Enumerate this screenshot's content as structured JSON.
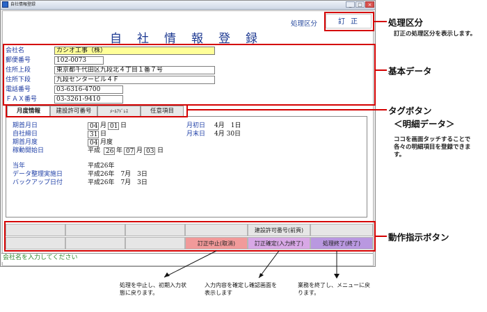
{
  "window": {
    "title": "自社情報登録",
    "controls": [
      "_",
      "□",
      "×"
    ]
  },
  "header": {
    "mode_label": "処理区分",
    "mode_value": "訂正",
    "page_title": "自社情報登録"
  },
  "basic_data": {
    "fields": [
      {
        "label": "会社名",
        "value": "カシオ工事（株）"
      },
      {
        "label": "郵便番号",
        "value": "102-0073"
      },
      {
        "label": "住所上段",
        "value": "東京都千代田区九段北４丁目１番７号"
      },
      {
        "label": "住所下段",
        "value": "九段センタービル４Ｆ"
      },
      {
        "label": "電話番号",
        "value": "03-6316-4700"
      },
      {
        "label": "ＦＡＸ番号",
        "value": "03-3261-9410"
      }
    ]
  },
  "tabs": [
    {
      "label": "月度情報"
    },
    {
      "label": "建設許可番号"
    },
    {
      "label": "ﾒｰﾙｱﾄﾞﾚｽ"
    },
    {
      "label": "任意項目"
    }
  ],
  "detail": {
    "period_start_month": {
      "label": "期首月日",
      "month": "04",
      "month_unit": "月",
      "day": "01",
      "day_unit": "日"
    },
    "closing_day": {
      "label": "自社締日",
      "value": "31",
      "unit": "日"
    },
    "period_start_fy": {
      "label": "期首月度",
      "value": "04",
      "unit": "月度"
    },
    "operation_start": {
      "label": "稼動開始日",
      "era": "平成",
      "year": "26",
      "year_unit": "年",
      "month": "07",
      "month_unit": "月",
      "day": "03",
      "day_unit": "日"
    },
    "month_first": {
      "label": "月初日",
      "value": "4月　1日"
    },
    "month_end": {
      "label": "月末日",
      "value": "4月 30日"
    },
    "current_year": {
      "label": "当年",
      "value": "平成26年"
    },
    "data_cleanup": {
      "label": "データ整理実施日",
      "value": "平成26年　7月　3日"
    },
    "backup_date": {
      "label": "バックアップ日付",
      "value": "平成26年　7月　3日"
    }
  },
  "action_buttons": {
    "top_row": [
      "",
      "",
      "",
      "",
      "",
      "建設許可番号(前頁)",
      ""
    ],
    "bottom_row": [
      "",
      "",
      "",
      "",
      "訂正中止(取消)",
      "訂正確定(入力終了)",
      "処理終了(終了)"
    ]
  },
  "status_bar": {
    "message": "会社名を入力してください"
  },
  "annotations": {
    "mode_heading": "処理区分",
    "mode_note": "訂正の処理区分を表示します。",
    "basic_heading": "基本データ",
    "tab_heading": "タグボタン",
    "tab_subheading": "＜明細データ＞",
    "tab_note": "ココを画面タッチすることで各々の明細項目を登録できます。",
    "action_heading": "動作指示ボタン",
    "cancel_note": "処理を中止し、初期入力状態に戻ります。",
    "confirm_note": "入力内容を確定し確認画面を表示します",
    "exit_note": "業務を終了し、メニューに戻ります。"
  },
  "colors": {
    "annotation_red": "#d40000",
    "label_blue": "#1e3aa0",
    "active_input": "#ffff99",
    "cancel_button": "#f19a9a",
    "confirm_button": "#d8a8e6",
    "exit_button": "#b998e0",
    "status_green": "#2f8a2f"
  }
}
